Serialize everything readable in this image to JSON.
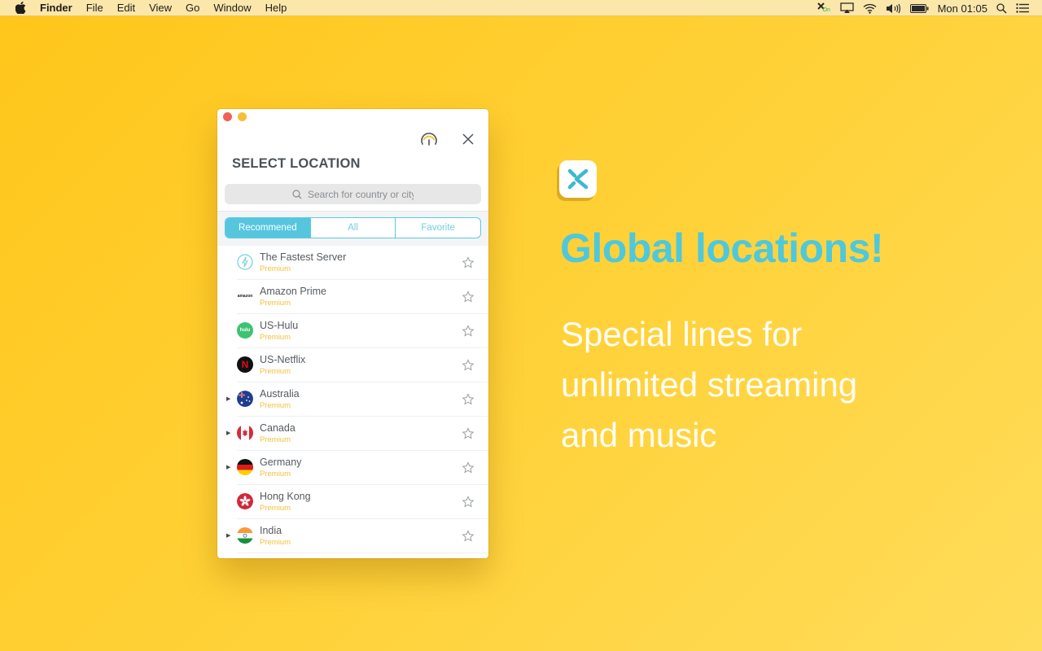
{
  "menubar": {
    "app_name": "Finder",
    "items": [
      "File",
      "Edit",
      "View",
      "Go",
      "Window",
      "Help"
    ],
    "status_icons": [
      "vpn-status-icon",
      "airplay-icon",
      "wifi-icon",
      "volume-icon",
      "battery-icon"
    ],
    "vpn_badge": "On",
    "clock": "Mon 01:05"
  },
  "window": {
    "title": "SELECT LOCATION",
    "search": {
      "placeholder": "Search for country or city",
      "value": ""
    },
    "tabs": [
      {
        "label": "Recommened",
        "active": true
      },
      {
        "label": "All",
        "active": false
      },
      {
        "label": "Favorite",
        "active": false
      }
    ],
    "locations": [
      {
        "name": "The Fastest Server",
        "tier": "Premium",
        "icon": "lightning-icon",
        "expandable": false,
        "favorite": false
      },
      {
        "name": "Amazon Prime",
        "tier": "Premium",
        "icon": "amazon-logo",
        "expandable": false,
        "favorite": false
      },
      {
        "name": "US-Hulu",
        "tier": "Premium",
        "icon": "hulu-logo",
        "expandable": false,
        "favorite": false
      },
      {
        "name": "US-Netflix",
        "tier": "Premium",
        "icon": "netflix-logo",
        "expandable": false,
        "favorite": false
      },
      {
        "name": "Australia",
        "tier": "Premium",
        "icon": "flag-australia",
        "expandable": true,
        "favorite": false
      },
      {
        "name": "Canada",
        "tier": "Premium",
        "icon": "flag-canada",
        "expandable": true,
        "favorite": false
      },
      {
        "name": "Germany",
        "tier": "Premium",
        "icon": "flag-germany",
        "expandable": true,
        "favorite": false
      },
      {
        "name": "Hong Kong",
        "tier": "Premium",
        "icon": "flag-hong-kong",
        "expandable": false,
        "favorite": false
      },
      {
        "name": "India",
        "tier": "Premium",
        "icon": "flag-india",
        "expandable": true,
        "favorite": false
      }
    ],
    "logo_text": {
      "hulu": "hulu",
      "amazon": "amazon",
      "netflix": "N"
    }
  },
  "promo": {
    "headline": "Global locations!",
    "subline": [
      "Special lines for",
      "unlimited streaming",
      "and music"
    ]
  },
  "colors": {
    "accent": "#56c6df",
    "premium": "#f2c13c",
    "background": "#ffc61a"
  }
}
